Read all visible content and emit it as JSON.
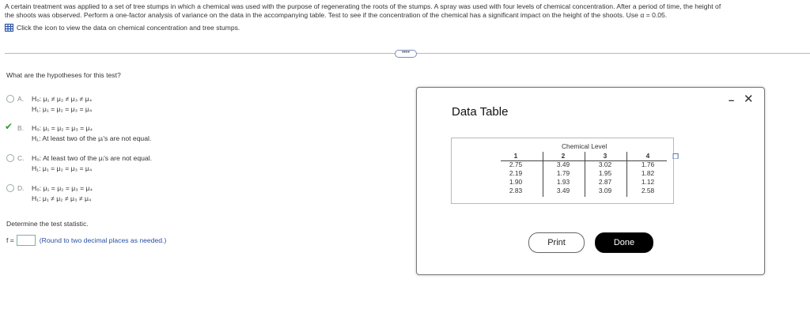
{
  "intro": {
    "line1": "A certain treatment was applied to a set of tree stumps in which a chemical was used with the purpose of regenerating the roots of the stumps. A spray was used with four levels of chemical concentration. After a period of time, the height of",
    "line2": "the shoots was observed. Perform a one-factor analysis of variance on the data in the accompanying table. Test to see if the concentration of the chemical has a significant impact on the height of the shoots. Use α = 0.05.",
    "data_link": "Click the icon to view the data on chemical concentration and tree stumps."
  },
  "more_button": "••••",
  "question": "What are the hypotheses for this test?",
  "options": [
    {
      "letter": "A.",
      "h0": "H₀: μ₁ ≠ μ₂ ≠ μ₃ ≠ μ₄",
      "h1": "H₁: μ₁ = μ₂ = μ₃ = μ₄"
    },
    {
      "letter": "B.",
      "h0": "H₀: μ₁ = μ₂ = μ₃ = μ₄",
      "h1": "H₁: At least two of the μᵢ's are not equal."
    },
    {
      "letter": "C.",
      "h0": "H₀: At least two of the μᵢ's are not equal.",
      "h1": "H₁: μ₁ = μ₂ = μ₃ = μ₄"
    },
    {
      "letter": "D.",
      "h0": "H₀: μ₁ = μ₂ = μ₃ = μ₄",
      "h1": "H₁: μ₁ ≠ μ₂ ≠ μ₃ ≠ μ₄"
    }
  ],
  "selected_option": "B.",
  "determine": "Determine the test statistic.",
  "f_label": "f =",
  "f_value": "",
  "f_hint": "(Round to two decimal places as needed.)",
  "dialog": {
    "title": "Data Table",
    "minimize": "–",
    "close": "✕",
    "caption": "Chemical Level",
    "columns": [
      {
        "header": "1",
        "values": [
          "2.75",
          "2.19",
          "1.90",
          "2.83"
        ]
      },
      {
        "header": "2",
        "values": [
          "3.49",
          "1.79",
          "1.93",
          "3.49"
        ]
      },
      {
        "header": "3",
        "values": [
          "3.02",
          "1.95",
          "2.87",
          "3.09"
        ]
      },
      {
        "header": "4",
        "values": [
          "1.76",
          "1.82",
          "1.12",
          "2.58"
        ]
      }
    ],
    "print_label": "Print",
    "done_label": "Done"
  },
  "colors": {
    "accent": "#2a4fa0",
    "correct": "#3a9a3a"
  }
}
